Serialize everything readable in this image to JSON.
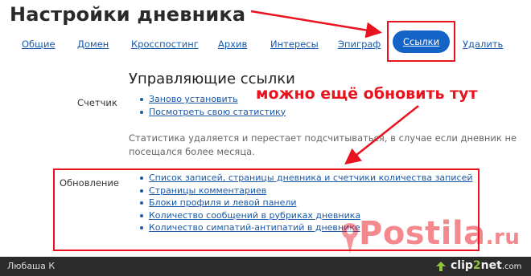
{
  "page": {
    "title": "Настройки дневника"
  },
  "tabs": [
    {
      "label": "Общие"
    },
    {
      "label": "Домен"
    },
    {
      "label": "Кросспостинг"
    },
    {
      "label": "Архив"
    },
    {
      "label": "Интересы"
    },
    {
      "label": "Эпиграф"
    },
    {
      "label": "Ссылки",
      "active": true
    },
    {
      "label": "Удалить"
    }
  ],
  "section": {
    "heading": "Управляющие ссылки"
  },
  "counter": {
    "label": "Счетчик",
    "links": [
      "Заново установить",
      "Посмотреть свою статистику"
    ]
  },
  "stats_note": "Статистика удаляется и перестает подсчитываться, в случае если дневник не посещался более месяца.",
  "update": {
    "label": "Обновление",
    "links": [
      "Список записей, страницы дневника и счетчики количества записей",
      "Страницы комментариев",
      "Блоки профиля и левой панели",
      "Количество сообщений в рубриках дневника",
      "Количество симпатий-антипатий в дневнике"
    ]
  },
  "annotation": {
    "text": "можно ещё обновить тут",
    "color": "#e8131f"
  },
  "watermark": {
    "brand": "Postila",
    "suffix": ".ru"
  },
  "footer": {
    "user": "Любаша К",
    "brand_left": "clip",
    "brand_mid": "2",
    "brand_right": "net",
    "brand_tld": ".com"
  },
  "colors": {
    "link": "#1a5aa8",
    "active_tab": "#1463c7",
    "highlight": "#e8131f"
  }
}
